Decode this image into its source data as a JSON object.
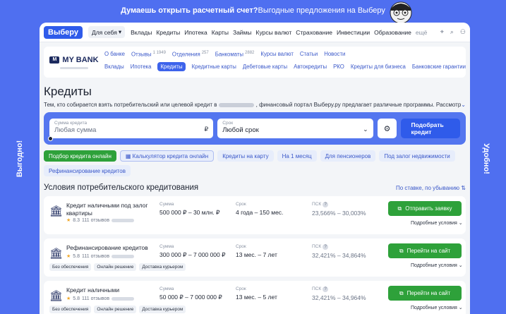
{
  "banner": {
    "lead": "Думаешь открыть расчетный счет?",
    "text": " Выгодные предложения на Выберу"
  },
  "side": {
    "left": "Выгодно!",
    "right": "Удобно!"
  },
  "nav": {
    "logo": "Выберу",
    "dropdown": "Для себя",
    "items": [
      "Вклады",
      "Кредиты",
      "Ипотека",
      "Карты",
      "Займы",
      "Курсы валют",
      "Страхование",
      "Инвестиции",
      "Образование"
    ],
    "more": "ещё"
  },
  "bank": {
    "name": "MY BANK",
    "row1": [
      {
        "label": "О банке",
        "count": ""
      },
      {
        "label": "Отзывы",
        "count": "1 1949"
      },
      {
        "label": "Отделения",
        "count": "257"
      },
      {
        "label": "Банкоматы",
        "count": "2882"
      },
      {
        "label": "Курсы валют",
        "count": ""
      },
      {
        "label": "Статьи",
        "count": ""
      },
      {
        "label": "Новости",
        "count": ""
      }
    ],
    "row2": [
      "Вклады",
      "Ипотека",
      "Кредиты",
      "Кредитные карты",
      "Дебетовые карты",
      "Автокредиты",
      "РКО",
      "Кредиты для бизнеса",
      "Банковские гарантии"
    ],
    "active": "Кредиты"
  },
  "page": {
    "title": "Кредиты",
    "lead_start": "Тем, кто собирается взять потребительский или целевой кредит в",
    "lead_end": ", финансовый портал Выберу.ру предлагает различные программы. Рассмотр"
  },
  "filter": {
    "sum_label": "Сумма кредита",
    "sum_placeholder": "Любая сумма",
    "sum_suffix": "₽",
    "term_label": "Срок",
    "term_value": "Любой срок",
    "button": "Подобрать кредит"
  },
  "chips": [
    "Подбор кредита онлайн",
    "Калькулятор кредита онлайн",
    "Кредиты на карту",
    "На 1 месяц",
    "Для пенсионеров",
    "Под залог недвижимости",
    "Рефинансирование кредитов"
  ],
  "section": {
    "title": "Условия потребительского кредитования",
    "sort": "По ставке, по убыванию"
  },
  "columns": {
    "sum": "Сумма",
    "term": "Срок",
    "psk": "ПСК"
  },
  "offers": [
    {
      "name": "Кредит наличными под залог квартиры",
      "rating": "8.3",
      "reviews": "111 отзывов",
      "sum": "500 000 ₽ – 30 млн. ₽",
      "term": "4 года – 150 мес.",
      "psk": "23,566% – 30,003%",
      "action": "Отправить заявку",
      "details": "Подробные условия",
      "tags": []
    },
    {
      "name": "Рефинансирование кредитов",
      "rating": "5.8",
      "reviews": "111 отзывов",
      "sum": "300 000 ₽ – 7 000 000 ₽",
      "term": "13 мес. – 7 лет",
      "psk": "32,421% – 34,864%",
      "action": "Перейти на сайт",
      "details": "Подробные условия",
      "tags": [
        "Без обеспечения",
        "Онлайн решение",
        "Доставка курьером"
      ]
    },
    {
      "name": "Кредит наличными",
      "rating": "5.8",
      "reviews": "111 отзывов",
      "sum": "50 000 ₽ – 7 000 000 ₽",
      "term": "13 мес. – 5 лет",
      "psk": "32,421% – 34,964%",
      "action": "Перейти на сайт",
      "details": "Подробные условия",
      "tags": [
        "Без обеспечения",
        "Онлайн решение",
        "Доставка курьером"
      ]
    }
  ],
  "colors": {
    "accent": "#2f5bea",
    "frame": "#4f6ff0",
    "success": "#2ea13a"
  }
}
